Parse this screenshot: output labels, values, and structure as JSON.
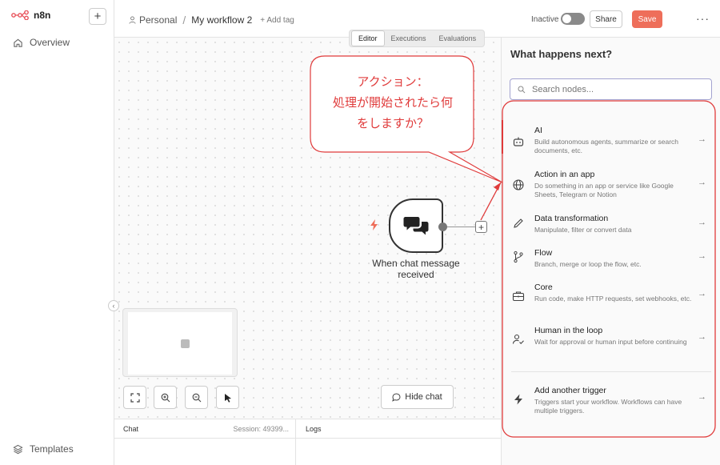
{
  "app": {
    "logo": "n8n"
  },
  "sidebar": {
    "overview_label": "Overview",
    "templates_label": "Templates"
  },
  "header": {
    "project": "Personal",
    "workflow_name": "My workflow 2",
    "add_tag": "+ Add tag",
    "status_label": "Inactive",
    "share_label": "Share",
    "save_label": "Save",
    "more": "···"
  },
  "canvas": {
    "tabs": [
      {
        "label": "Editor",
        "active": true
      },
      {
        "label": "Executions",
        "active": false
      },
      {
        "label": "Evaluations",
        "active": false
      }
    ],
    "node": {
      "label_line1": "When chat message",
      "label_line2": "received"
    },
    "hide_chat_label": "Hide chat"
  },
  "bottom": {
    "chat_title": "Chat",
    "session": "Session: 49399...",
    "logs_title": "Logs"
  },
  "panel": {
    "title": "What happens next?",
    "search_placeholder": "Search nodes...",
    "items": [
      {
        "name": "AI",
        "desc": "Build autonomous agents, summarize or search documents, etc.",
        "icon": "robot-icon"
      },
      {
        "name": "Action in an app",
        "desc": "Do something in an app or service like Google Sheets, Telegram or Notion",
        "icon": "globe-icon"
      },
      {
        "name": "Data transformation",
        "desc": "Manipulate, filter or convert data",
        "icon": "pen-icon"
      },
      {
        "name": "Flow",
        "desc": "Branch, merge or loop the flow, etc.",
        "icon": "branch-icon"
      },
      {
        "name": "Core",
        "desc": "Run code, make HTTP requests, set webhooks, etc.",
        "icon": "toolbox-icon"
      },
      {
        "name": "Human in the loop",
        "desc": "Wait for approval or human input before continuing",
        "icon": "user-check-icon"
      }
    ],
    "trigger": {
      "name": "Add another trigger",
      "desc": "Triggers start your workflow. Workflows can have multiple triggers.",
      "icon": "bolt-icon"
    }
  },
  "annotation": {
    "line1": "アクション：",
    "line2": "処理が開始されたら何",
    "line3": "をしますか？",
    "color": "#e03b3b"
  }
}
